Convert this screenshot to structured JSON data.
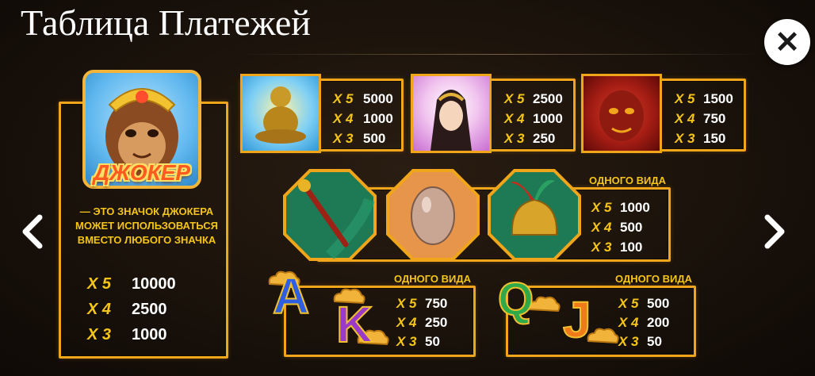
{
  "header": {
    "title": "Таблица Платежей"
  },
  "joker": {
    "label": "ДЖОКЕР",
    "description": "— ЭТО ЗНАЧОК ДЖОКЕРА МОЖЕТ ИСПОЛЬЗОВАТЬСЯ ВМЕСТО ЛЮБОГО ЗНАЧКА",
    "pays": [
      {
        "mult": "X 5",
        "value": "10000"
      },
      {
        "mult": "X 4",
        "value": "2500"
      },
      {
        "mult": "X 3",
        "value": "1000"
      }
    ]
  },
  "symbols": {
    "buddha": {
      "pays": [
        {
          "mult": "X 5",
          "value": "5000"
        },
        {
          "mult": "X 4",
          "value": "1000"
        },
        {
          "mult": "X 3",
          "value": "500"
        }
      ]
    },
    "goddess": {
      "pays": [
        {
          "mult": "X 5",
          "value": "2500"
        },
        {
          "mult": "X 4",
          "value": "1000"
        },
        {
          "mult": "X 3",
          "value": "250"
        }
      ]
    },
    "demon": {
      "pays": [
        {
          "mult": "X 5",
          "value": "1500"
        },
        {
          "mult": "X 4",
          "value": "750"
        },
        {
          "mult": "X 3",
          "value": "150"
        }
      ]
    },
    "items_group": {
      "label": "ОДНОГО ВИДА",
      "pays": [
        {
          "mult": "X 5",
          "value": "1000"
        },
        {
          "mult": "X 4",
          "value": "500"
        },
        {
          "mult": "X 3",
          "value": "100"
        }
      ]
    },
    "ak_group": {
      "label": "ОДНОГО ВИДА",
      "letters": [
        "A",
        "K"
      ],
      "pays": [
        {
          "mult": "X 5",
          "value": "750"
        },
        {
          "mult": "X 4",
          "value": "250"
        },
        {
          "mult": "X 3",
          "value": "50"
        }
      ]
    },
    "qj_group": {
      "label": "ОДНОГО ВИДА",
      "letters": [
        "Q",
        "J"
      ],
      "pays": [
        {
          "mult": "X 5",
          "value": "500"
        },
        {
          "mult": "X 4",
          "value": "200"
        },
        {
          "mult": "X 3",
          "value": "50"
        }
      ]
    }
  },
  "colors": {
    "gold": "#f0a51a",
    "accent_yellow": "#f5c518",
    "background": "#1a120b"
  },
  "icons": {
    "close": "close-icon",
    "prev": "chevron-left-icon",
    "next": "chevron-right-icon"
  }
}
